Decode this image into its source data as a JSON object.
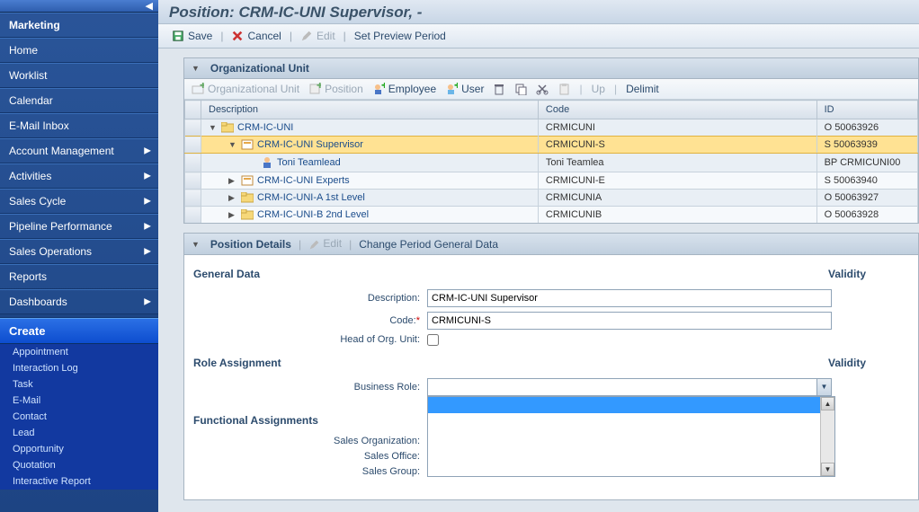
{
  "page_title": "Position: CRM-IC-UNI Supervisor, -",
  "main_toolbar": {
    "save": "Save",
    "cancel": "Cancel",
    "edit": "Edit",
    "set_preview": "Set Preview Period"
  },
  "sidebar": {
    "items": [
      {
        "label": "Marketing",
        "expandable": false
      },
      {
        "label": "Home",
        "expandable": false
      },
      {
        "label": "Worklist",
        "expandable": false
      },
      {
        "label": "Calendar",
        "expandable": false
      },
      {
        "label": "E-Mail Inbox",
        "expandable": false
      },
      {
        "label": "Account Management",
        "expandable": true
      },
      {
        "label": "Activities",
        "expandable": true
      },
      {
        "label": "Sales Cycle",
        "expandable": true
      },
      {
        "label": "Pipeline Performance",
        "expandable": true
      },
      {
        "label": "Sales Operations",
        "expandable": true
      },
      {
        "label": "Reports",
        "expandable": false
      },
      {
        "label": "Dashboards",
        "expandable": true
      }
    ],
    "create_header": "Create",
    "create": [
      "Appointment",
      "Interaction Log",
      "Task",
      "E-Mail",
      "Contact",
      "Lead",
      "Opportunity",
      "Quotation",
      "Interactive Report"
    ]
  },
  "org_panel": {
    "title": "Organizational Unit",
    "toolbar": {
      "org_unit": "Organizational Unit",
      "position": "Position",
      "employee": "Employee",
      "user": "User",
      "up": "Up",
      "delimit": "Delimit"
    },
    "columns": {
      "desc": "Description",
      "code": "Code",
      "id": "ID"
    },
    "rows": [
      {
        "level": 0,
        "expand": "down",
        "icon": "folder",
        "desc": "CRM-IC-UNI",
        "code": "CRMICUNI",
        "id": "O 50063926",
        "sel": false
      },
      {
        "level": 1,
        "expand": "down",
        "icon": "position",
        "desc": "CRM-IC-UNI Supervisor",
        "code": "CRMICUNI-S",
        "id": "S 50063939",
        "sel": true
      },
      {
        "level": 2,
        "expand": "none",
        "icon": "person",
        "desc": "Toni Teamlead",
        "code": "Toni Teamlea",
        "id": "BP CRMICUNI00",
        "sel": false
      },
      {
        "level": 1,
        "expand": "right",
        "icon": "position",
        "desc": "CRM-IC-UNI Experts",
        "code": "CRMICUNI-E",
        "id": "S 50063940",
        "sel": false
      },
      {
        "level": 1,
        "expand": "right",
        "icon": "folder",
        "desc": "CRM-IC-UNI-A 1st Level",
        "code": "CRMICUNIA",
        "id": "O 50063927",
        "sel": false
      },
      {
        "level": 1,
        "expand": "right",
        "icon": "folder",
        "desc": "CRM-IC-UNI-B 2nd Level",
        "code": "CRMICUNIB",
        "id": "O 50063928",
        "sel": false
      }
    ]
  },
  "detail_panel": {
    "title": "Position Details",
    "edit": "Edit",
    "change_period": "Change Period General Data",
    "sections": {
      "general": "General Data",
      "validity": "Validity",
      "role": "Role Assignment",
      "functional": "Functional Assignments"
    },
    "labels": {
      "description": "Description:",
      "code": "Code:",
      "head": "Head of Org. Unit:",
      "business_role": "Business Role:",
      "sales_org": "Sales Organization:",
      "sales_office": "Sales Office:",
      "sales_group": "Sales Group:"
    },
    "values": {
      "description": "CRM-IC-UNI Supervisor",
      "code": "CRMICUNI-S",
      "head": false,
      "business_role": ""
    }
  }
}
